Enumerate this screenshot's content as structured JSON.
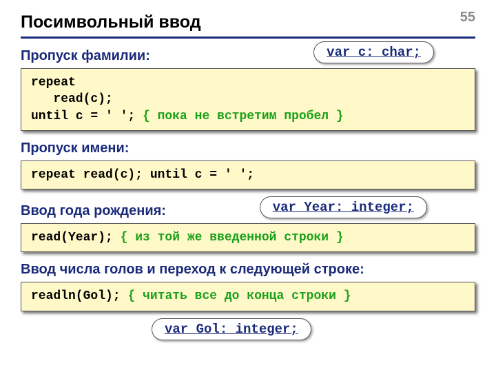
{
  "page_number": "55",
  "title": "Посимвольный ввод",
  "sections": {
    "s1": {
      "label": "Пропуск фамилии:",
      "callout": "var c: char;",
      "code_l1": "repeat",
      "code_l2": "   read(c);",
      "code_l3a": "until c = ' '; ",
      "code_l3b": "{ пока не встретим пробел }"
    },
    "s2": {
      "label": "Пропуск имени:",
      "code": "repeat read(c); until c = ' ';"
    },
    "s3": {
      "label": "Ввод года рождения:",
      "callout": "var Year: integer;",
      "code_a": "read(Year); ",
      "code_b": "{ из той же введенной строки }"
    },
    "s4": {
      "label": "Ввод числа голов и переход к следующей строке:",
      "code_a": "readln(Gol); ",
      "code_b": "{ читать все до конца строки }",
      "callout": "var Gol: integer;"
    }
  }
}
